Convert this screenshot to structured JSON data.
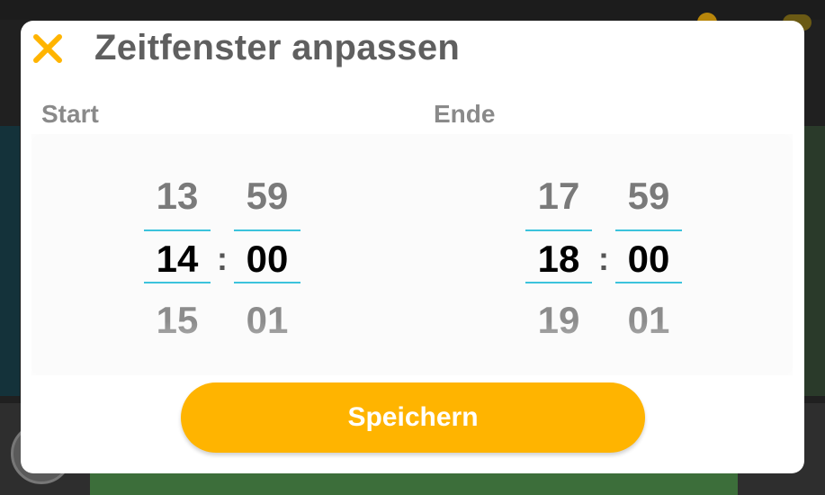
{
  "dialog": {
    "title": "Zeitfenster anpassen",
    "close_icon": "close-icon",
    "accent_color": "#ffb400",
    "selection_line_color": "#3cc3dc"
  },
  "start": {
    "label": "Start",
    "hour": {
      "prev": "13",
      "current": "14",
      "next": "15"
    },
    "minute": {
      "prev": "59",
      "current": "00",
      "next": "01"
    },
    "separator": ":"
  },
  "end": {
    "label": "Ende",
    "hour": {
      "prev": "17",
      "current": "18",
      "next": "19"
    },
    "minute": {
      "prev": "59",
      "current": "00",
      "next": "01"
    },
    "separator": ":"
  },
  "actions": {
    "save_label": "Speichern"
  }
}
